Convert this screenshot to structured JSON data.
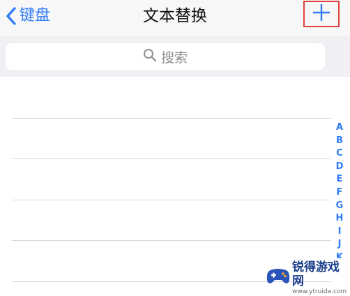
{
  "navbar": {
    "back_label": "键盘",
    "title": "文本替换",
    "add_symbol": "+"
  },
  "search": {
    "placeholder": "搜索"
  },
  "index_letters": [
    "A",
    "B",
    "C",
    "D",
    "E",
    "F",
    "G",
    "H",
    "I",
    "J",
    "K"
  ],
  "watermark": {
    "name": "锐得游戏网",
    "url": "www.ytruida.com"
  },
  "colors": {
    "accent": "#2f7cf6",
    "highlight_box": "#e0413c",
    "separator": "#d9d9dd"
  }
}
